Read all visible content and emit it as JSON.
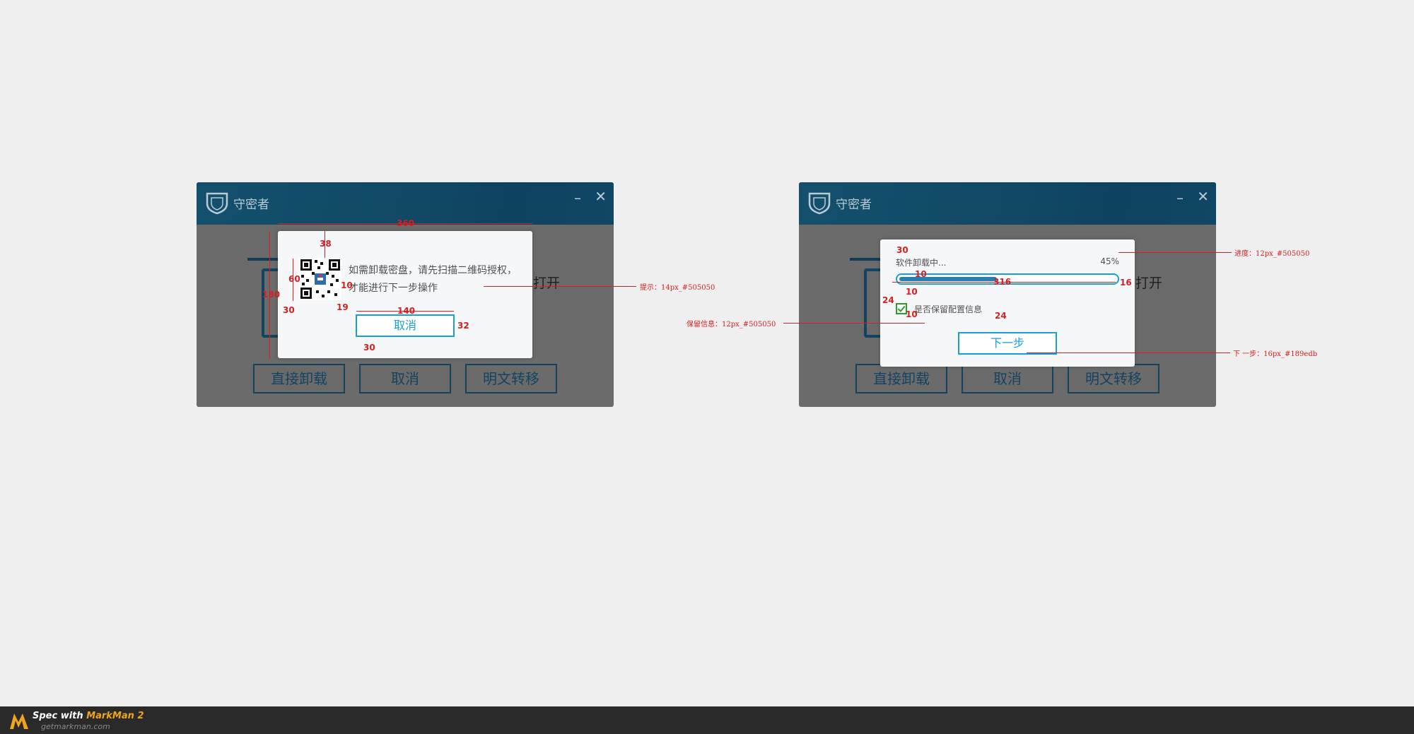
{
  "app": {
    "title": "守密者",
    "minimize": "–",
    "close": "✕"
  },
  "background": {
    "open_label": "打开",
    "buttons": [
      "直接卸载",
      "取消",
      "明文转移"
    ]
  },
  "qr_dialog": {
    "tip_line1": "如需卸载密盘，请先扫描二维码授权，",
    "tip_line2": "才能进行下一步操作",
    "cancel_label": "取消"
  },
  "progress_dialog": {
    "label": "软件卸载中...",
    "percent_text": "45%",
    "progress": 0.45,
    "keep_config_label": "是否保留配置信息",
    "keep_config_checked": true,
    "next_label": "下一步"
  },
  "annotations": {
    "tip": "提示：14px_#505050",
    "progress": "进度：12px_#505050",
    "keep_info": "保留信息：12px_#505050",
    "next_step": "下 一步：16px_#189edb"
  },
  "dimensions": {
    "w360": "360",
    "h38": "38",
    "h60": "60",
    "w10": "10",
    "h180": "180",
    "w30": "30",
    "h19": "19",
    "w140": "140",
    "h32": "32",
    "h30b": "30",
    "p30": "30",
    "p10a": "10",
    "p316": "316",
    "p16": "16",
    "p24a": "24",
    "p10b": "10",
    "p10c": "10",
    "p24b": "24"
  },
  "footer": {
    "brand_prefix": "Spec with ",
    "brand_name": "MarkMan 2",
    "site": "getmarkman.com"
  },
  "colors": {
    "accent": "#189edb",
    "text": "#505050",
    "titlebar": "#104764",
    "annotation": "#d81e1e"
  }
}
